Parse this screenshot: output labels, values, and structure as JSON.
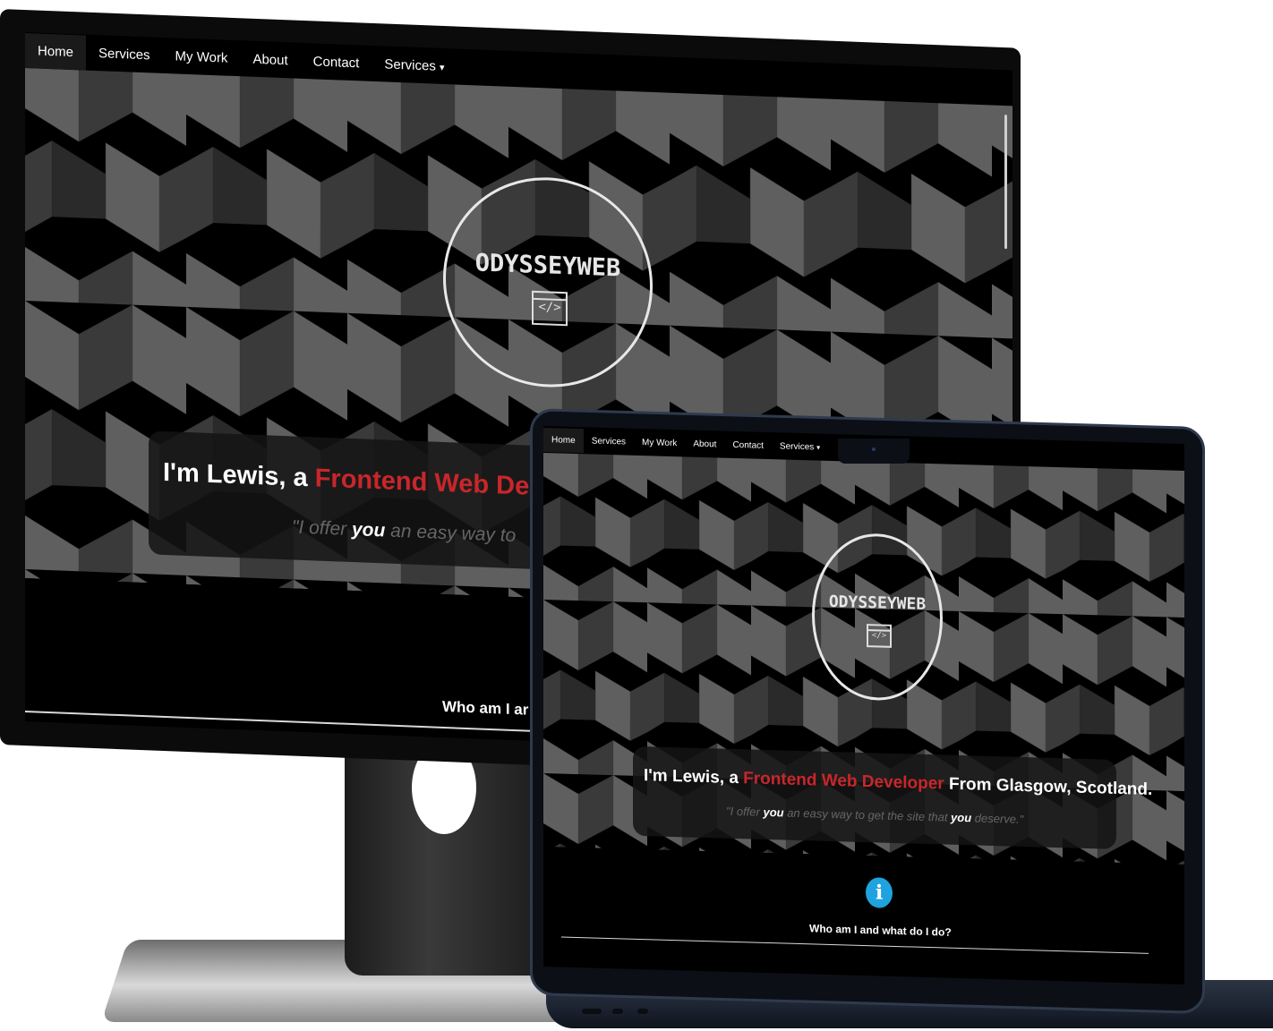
{
  "site": {
    "nav": {
      "home": "Home",
      "services": "Services",
      "my_work": "My Work",
      "about": "About",
      "contact": "Contact",
      "services_dropdown": "Services",
      "dropdown_caret": "▾"
    },
    "logo": {
      "text": "ODYSSEYWEB",
      "code_glyph": "</>"
    },
    "headline": {
      "prefix": "I'm Lewis, a ",
      "highlight": "Frontend Web Developer",
      "suffix": " From Glasgow, Scotland."
    },
    "tagline": {
      "open": "\"I offer ",
      "you1": "you",
      "middle": " an easy way to get the site that ",
      "you2": "you",
      "close": " deserve.\""
    },
    "monitor_crop": {
      "headline_highlight": "Frontend Web De",
      "tagline_middle": " an easy way to",
      "who_text": "Who am I ar"
    },
    "info_icon_glyph": "i",
    "who_text": "Who am I and what do I do?"
  },
  "colors": {
    "accent_red": "#c9262b",
    "info_blue": "#1fa3e0",
    "pattern_light": "#5f5f5f",
    "pattern_mid": "#3a3a3a",
    "pattern_dark": "#000000"
  }
}
